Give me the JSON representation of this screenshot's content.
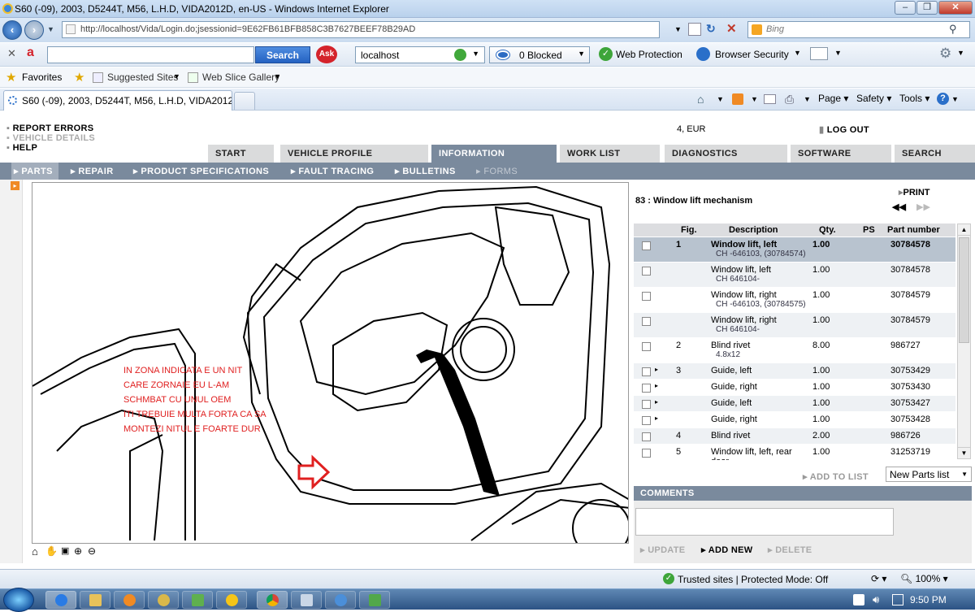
{
  "window": {
    "title": "S60 (-09), 2003, D5244T, M56, L.H.D, VIDA2012D, en-US - Windows Internet Explorer"
  },
  "addressbar": {
    "url": "http://localhost/Vida/Login.do;jsessionid=9E62FB61BFB858C3B7627BEEF78B29AD",
    "search_placeholder": "Bing"
  },
  "toolbar": {
    "search_label": "Search",
    "host_value": "localhost",
    "blocked_label": "0 Blocked",
    "web_protection": "Web Protection",
    "browser_security": "Browser Security"
  },
  "favorites": {
    "favorites": "Favorites",
    "suggested": "Suggested Sites",
    "webslice": "Web Slice Gallery"
  },
  "tabs": {
    "active_title": "S60 (-09), 2003, D5244T, M56, L.H.D, VIDA2012D, ...",
    "page": "Page",
    "safety": "Safety",
    "tools": "Tools"
  },
  "vida": {
    "links": {
      "report": "REPORT ERRORS",
      "vehicle": "VEHICLE DETAILS",
      "help": "HELP",
      "logout": "LOG OUT",
      "locale": "4, EUR"
    },
    "main_tabs": [
      "START",
      "VEHICLE PROFILE",
      "INFORMATION",
      "WORK LIST",
      "DIAGNOSTICS",
      "SOFTWARE",
      "SEARCH"
    ],
    "sub_tabs": [
      "PARTS",
      "REPAIR",
      "PRODUCT SPECIFICATIONS",
      "FAULT TRACING",
      "BULLETINS",
      "FORMS"
    ],
    "annotation": [
      "IN ZONA INDICATA E UN NIT",
      "CARE ZORNAIE EU L-AM",
      "SCHMBAT CU UNUL OEM",
      "ITI TREBUIE MULTA FORTA CA SA",
      "MONTEZI NITUL E FOARTE DUR"
    ],
    "part_title": "83 : Window lift mechanism",
    "print": "PRINT",
    "headers": {
      "fig": "Fig.",
      "desc": "Description",
      "qty": "Qty.",
      "ps": "PS",
      "pn": "Part number"
    },
    "rows": [
      {
        "fig": "1",
        "desc": "Window lift, left",
        "sub": "CH -646103, (30784574)",
        "qty": "1.00",
        "pn": "30784578"
      },
      {
        "fig": "",
        "desc": "Window lift, left",
        "sub": "CH 646104-",
        "qty": "1.00",
        "pn": "30784578"
      },
      {
        "fig": "",
        "desc": "Window lift, right",
        "sub": "CH -646103, (30784575)",
        "qty": "1.00",
        "pn": "30784579"
      },
      {
        "fig": "",
        "desc": "Window lift, right",
        "sub": "CH 646104-",
        "qty": "1.00",
        "pn": "30784579"
      },
      {
        "fig": "2",
        "desc": "Blind rivet",
        "sub": "4.8x12",
        "qty": "8.00",
        "pn": "986727"
      },
      {
        "fig": "3",
        "desc": "Guide, left",
        "sub": "",
        "qty": "1.00",
        "pn": "30753429"
      },
      {
        "fig": "",
        "desc": "Guide, right",
        "sub": "",
        "qty": "1.00",
        "pn": "30753430"
      },
      {
        "fig": "",
        "desc": "Guide, left",
        "sub": "",
        "qty": "1.00",
        "pn": "30753427"
      },
      {
        "fig": "",
        "desc": "Guide, right",
        "sub": "",
        "qty": "1.00",
        "pn": "30753428"
      },
      {
        "fig": "4",
        "desc": "Blind rivet",
        "sub": "",
        "qty": "2.00",
        "pn": "986726"
      },
      {
        "fig": "5",
        "desc": "Window lift, left, rear",
        "sub": "door",
        "qty": "1.00",
        "pn": "31253719"
      }
    ],
    "add_to_list": "ADD TO LIST",
    "new_parts_list": "New Parts list",
    "comments": "COMMENTS",
    "update": "UPDATE",
    "add_new": "ADD NEW",
    "delete": "DELETE"
  },
  "status": {
    "zone": "Trusted sites | Protected Mode: Off",
    "zoom": "100%"
  },
  "taskbar": {
    "time": "9:50 PM"
  },
  "colors": {
    "tab_active": "#7a8a9d",
    "annotation": "#e02020",
    "selected_row": "#b8c3cf"
  }
}
